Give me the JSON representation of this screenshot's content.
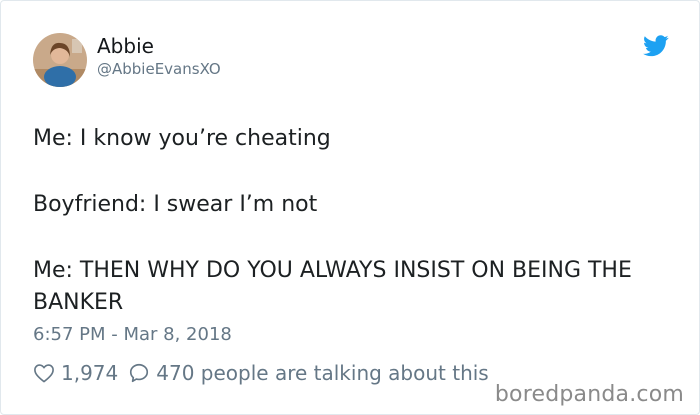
{
  "user": {
    "display_name": "Abbie",
    "handle": "@AbbieEvansXO"
  },
  "tweet": {
    "lines": [
      "Me: I know you’re cheating",
      "Boyfriend: I swear I’m not",
      "Me: THEN WHY DO YOU ALWAYS INSIST ON BEING THE BANKER"
    ],
    "timestamp": "6:57 PM - Mar 8, 2018"
  },
  "engagement": {
    "likes": "1,974",
    "replies_text": "470 people are talking about this"
  },
  "icons": {
    "platform": "twitter-bird-icon",
    "like": "heart-icon",
    "reply": "comment-bubble-icon"
  },
  "colors": {
    "brand": "#1da1f2",
    "text": "#1c2022",
    "muted": "#657786",
    "watermark": "#8a8a8a"
  },
  "watermark": "boredpanda.com"
}
